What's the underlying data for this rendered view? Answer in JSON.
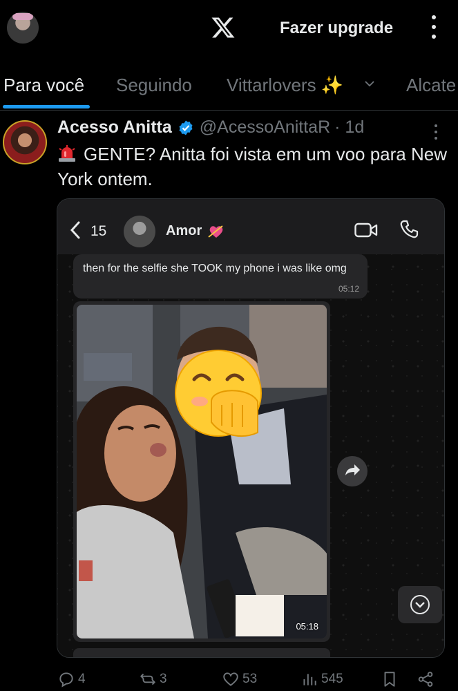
{
  "header": {
    "upgrade_label": "Fazer upgrade",
    "logo": "x-logo"
  },
  "tabs": [
    {
      "label": "Para você",
      "active": true
    },
    {
      "label": "Seguindo",
      "active": false
    },
    {
      "label": "Vittarlovers ✨",
      "active": false
    },
    {
      "label": "Alcate",
      "active": false
    }
  ],
  "tweet": {
    "author_name": "Acesso Anitta",
    "author_handle": "@AcessoAnittaR",
    "time": "· 1d",
    "text": "GENTE? Anitta foi vista em um voo para New York ontem.",
    "stats": {
      "replies": "4",
      "retweets": "3",
      "likes": "53",
      "views": "545"
    }
  },
  "media": {
    "back_count": "15",
    "contact_name": "Amor",
    "message_text": "then for the selfie she TOOK my phone i was like omg",
    "message_time": "05:12",
    "photo_time": "05:18"
  },
  "colors": {
    "accent": "#1d9bf0",
    "background": "#000000",
    "muted": "#71767b",
    "text": "#e7e9ea"
  }
}
